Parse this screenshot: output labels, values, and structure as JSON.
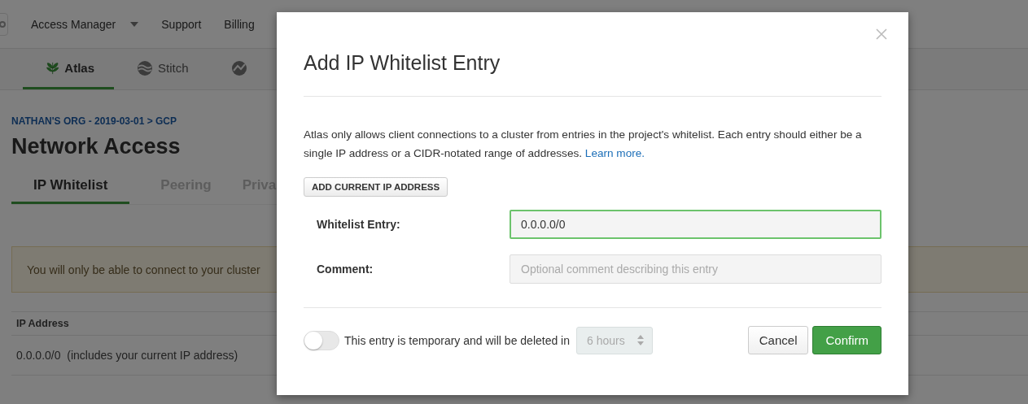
{
  "top_nav": {
    "items": [
      {
        "label": "Access Manager",
        "kind": "dropdown"
      },
      {
        "label": "Support",
        "kind": "link"
      },
      {
        "label": "Billing",
        "kind": "link"
      }
    ]
  },
  "product_tabs": [
    {
      "label": "Atlas",
      "selected": true
    },
    {
      "label": "Stitch",
      "selected": false
    },
    {
      "selected": false
    }
  ],
  "breadcrumb": "NATHAN'S ORG - 2019-03-01 > GCP",
  "page_title": "Network Access",
  "section_tabs": [
    {
      "label": "IP Whitelist",
      "selected": true
    },
    {
      "label": "Peering",
      "selected": false
    },
    {
      "label": "Priva",
      "selected": false
    }
  ],
  "notice": "You will only be able to connect to your cluster",
  "table": {
    "columns": [
      "IP Address"
    ],
    "rows": [
      [
        "0.0.0.0/0  (includes your current IP address)"
      ]
    ]
  },
  "dialog": {
    "title": "Add IP Whitelist Entry",
    "description": {
      "text": "Atlas only allows client connections to a cluster from entries in the project's whitelist. Each entry should either be a single IP address or a CIDR-notated range of addresses.",
      "link": "Learn more."
    },
    "add_current_ip_button": "ADD CURRENT IP ADDRESS",
    "fields": [
      {
        "label": "Whitelist Entry:",
        "value": "0.0.0.0/0",
        "focused": true
      },
      {
        "label": "Comment:",
        "placeholder": "Optional comment describing this entry",
        "focused": false
      }
    ],
    "temporary": {
      "on": false,
      "label": "This entry is temporary and will be deleted in",
      "duration": {
        "value": "6 hours",
        "disabled": true
      }
    },
    "buttons": [
      {
        "label": "Cancel",
        "kind": "secondary"
      },
      {
        "label": "Confirm",
        "kind": "primary"
      }
    ]
  }
}
